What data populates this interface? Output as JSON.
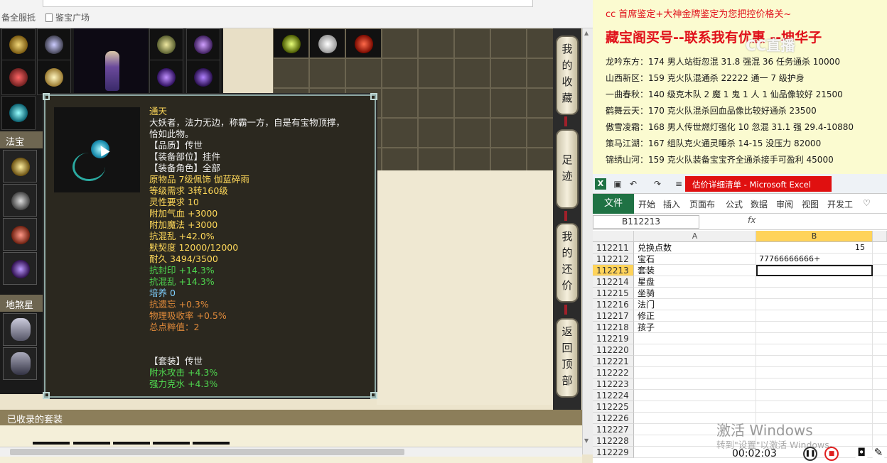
{
  "browser": {
    "bookmarks": [
      {
        "label": "备全服抵"
      },
      {
        "label": "鉴宝广场"
      }
    ]
  },
  "game": {
    "sections": {
      "fabao": "法宝",
      "disha": "地煞星哥"
    },
    "tooltip": {
      "name": "通天",
      "lines": [
        {
          "text": "大妖者，法力无边，称霸一方，自是有宝物顶撑，",
          "color": "white"
        },
        {
          "text": "恰如此物。",
          "color": "white"
        },
        {
          "text": "【品质】传世",
          "color": "white"
        },
        {
          "text": "【装备部位】挂件",
          "color": "white"
        },
        {
          "text": "【装备角色】全部",
          "color": "white"
        },
        {
          "text": "原物品 7级佩饰 伽蓝碎雨",
          "color": "yellow"
        },
        {
          "text": "等级需求 3转160级",
          "color": "yellow"
        },
        {
          "text": "灵性要求 10",
          "color": "yellow"
        },
        {
          "text": "附加气血 +3000",
          "color": "yellow"
        },
        {
          "text": "附加魔法 +3000",
          "color": "yellow"
        },
        {
          "text": "抗混乱 +42.0%",
          "color": "yellow"
        },
        {
          "text": "默契度 12000/12000",
          "color": "yellow"
        },
        {
          "text": "耐久 3494/3500",
          "color": "yellow"
        },
        {
          "text": "抗封印 +14.3%",
          "color": "green"
        },
        {
          "text": "抗混乱 +14.3%",
          "color": "green"
        },
        {
          "text": "培养 0",
          "color": "lblue"
        },
        {
          "text": "抗遗忘 +0.3%",
          "color": "orange"
        },
        {
          "text": "物理吸收率 +0.5%",
          "color": "orange"
        },
        {
          "text": "总点粹值：2",
          "color": "orange"
        },
        {
          "text": "",
          "color": "white"
        },
        {
          "text": "",
          "color": "white"
        },
        {
          "text": "【套装】传世",
          "color": "white"
        },
        {
          "text": "附水攻击 +4.3%",
          "color": "green"
        },
        {
          "text": "强力克水 +4.3%",
          "color": "green"
        }
      ]
    },
    "side_buttons": [
      "我的收藏",
      "足迹",
      "我的还价",
      "返回顶部"
    ],
    "collected_sets_label": "已收录的套装"
  },
  "ad": {
    "line1": "cc 首席鉴定+大神金牌鉴定为您把控价格关~",
    "title": "藏宝阁买号--联系我有优惠 --坤华子",
    "watermark": "CC直播",
    "rows": [
      "龙吟东方：174 男人站街忽混 31.8 强混 36 任务通杀 10000",
      "山西新区：159 克火队混通杀 22222 通一 7 级护身",
      "一曲春秋：140 级克木队 2 魔 1 鬼 1 人 1 仙品像较好 21500",
      "鹤舞云天：170 克火队混杀回血品像比较好通杀 23500",
      "傲雪凌霜：168 男人传世燃灯强化 10 忽混 31.1 强 29.4-10880",
      "策马江湖：167 组队克火通灵睡杀 14-15 没压力 82000",
      "锦绣山河：159 克火队装备宝宝齐全通杀接手可盈利 45000"
    ]
  },
  "excel": {
    "doc_title": "估价详细清单 - Microsoft Excel",
    "tabs": [
      "文件",
      "开始",
      "插入",
      "页面布",
      "公式",
      "数据",
      "审阅",
      "视图",
      "开发工"
    ],
    "namebox": "B112213",
    "fx": "fx",
    "col_headers": [
      "A",
      "B"
    ],
    "rows": [
      {
        "num": "112211",
        "a": "兑换点数",
        "b": "15"
      },
      {
        "num": "112212",
        "a": "宝石",
        "b": "77766666666+"
      },
      {
        "num": "112213",
        "a": "套装",
        "b": ""
      },
      {
        "num": "112214",
        "a": "星盘",
        "b": ""
      },
      {
        "num": "112215",
        "a": "坐骑",
        "b": ""
      },
      {
        "num": "112216",
        "a": "法门",
        "b": ""
      },
      {
        "num": "112217",
        "a": "修正",
        "b": ""
      },
      {
        "num": "112218",
        "a": "孩子",
        "b": ""
      },
      {
        "num": "112219",
        "a": "",
        "b": ""
      },
      {
        "num": "112220",
        "a": "",
        "b": ""
      },
      {
        "num": "112221",
        "a": "",
        "b": ""
      },
      {
        "num": "112222",
        "a": "",
        "b": ""
      },
      {
        "num": "112223",
        "a": "",
        "b": ""
      },
      {
        "num": "112224",
        "a": "",
        "b": ""
      },
      {
        "num": "112225",
        "a": "",
        "b": ""
      },
      {
        "num": "112226",
        "a": "",
        "b": ""
      },
      {
        "num": "112227",
        "a": "",
        "b": ""
      },
      {
        "num": "112228",
        "a": "",
        "b": ""
      },
      {
        "num": "112229",
        "a": "",
        "b": ""
      }
    ],
    "activate_title": "激活 Windows",
    "activate_sub": "转到\"设置\"以激活 Windows。",
    "record_time": "00:02:03"
  }
}
